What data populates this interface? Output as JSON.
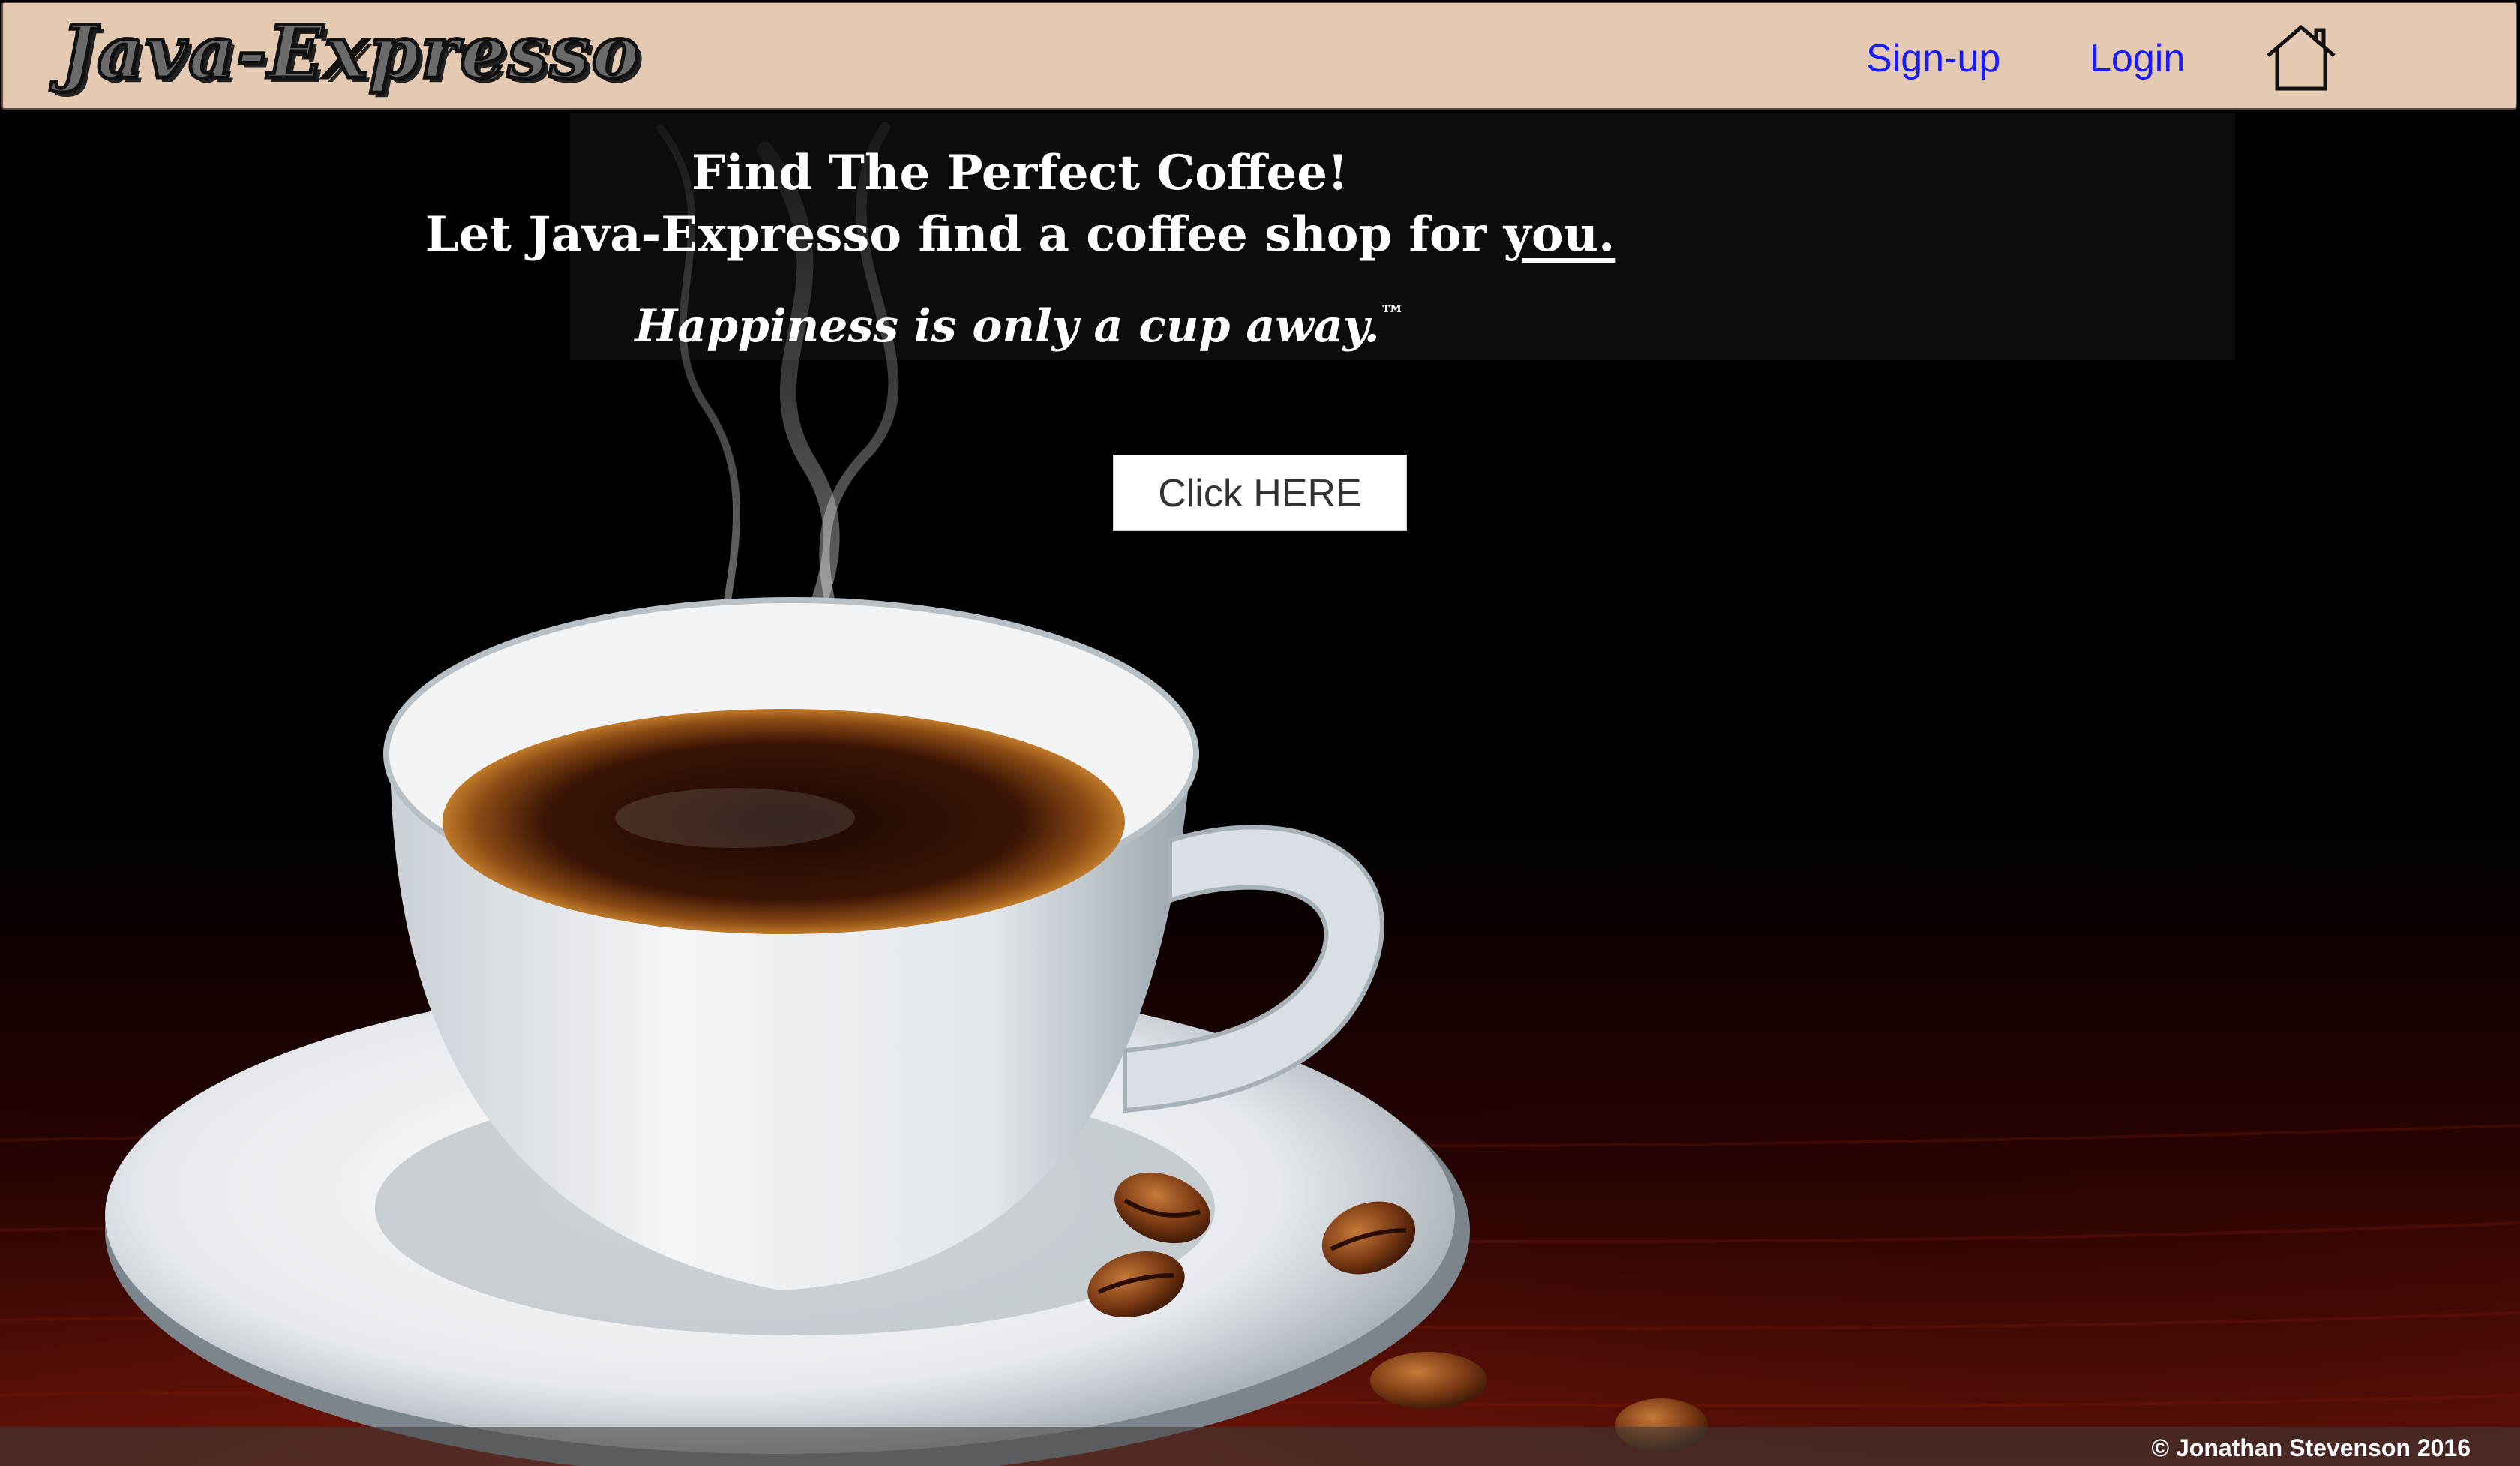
{
  "header": {
    "logo_text": "Java-Expresso",
    "nav": {
      "signup_label": "Sign-up",
      "login_label": "Login",
      "home_icon": "home-icon"
    }
  },
  "hero": {
    "headline_line1": "Find The Perfect Coffee!",
    "headline_line2_prefix": "Let Java-Expresso find a coffee shop for ",
    "headline_line2_emphasis": "you.",
    "tagline": "Happiness is only a cup away.",
    "tagline_mark": "™",
    "cta_label": "Click HERE"
  },
  "footer": {
    "copyright": "© Jonathan Stevenson 2016"
  },
  "colors": {
    "header_bg": "#e4c9b3",
    "link": "#1a1aff",
    "background": "#000000",
    "table_wood": "#5a0d06"
  }
}
